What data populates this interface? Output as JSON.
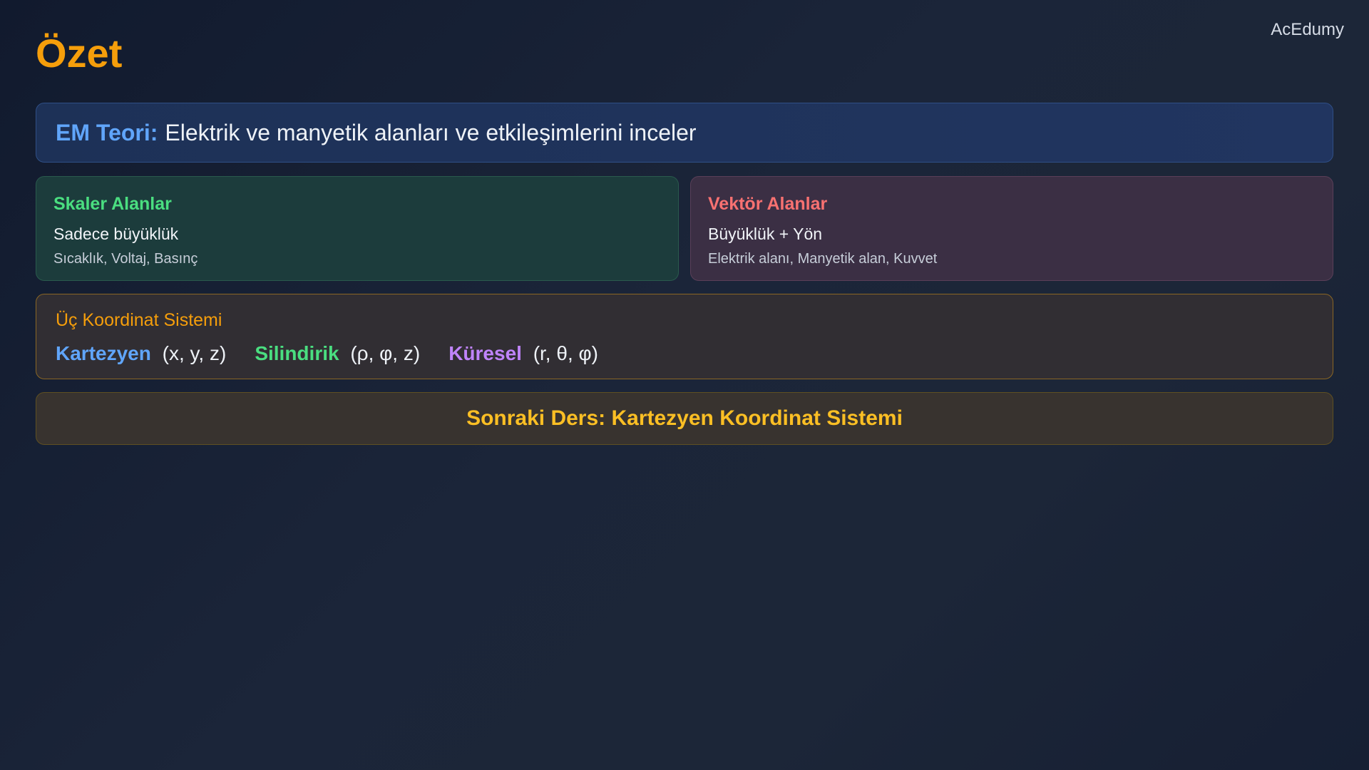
{
  "brand": "AcEdumy",
  "title": "Özet",
  "em_theory": {
    "label": "EM Teori:",
    "text": "Elektrik ve manyetik alanları ve etkileşimlerini inceler"
  },
  "scalar": {
    "title": "Skaler Alanlar",
    "subtitle": "Sadece büyüklük",
    "examples": "Sıcaklık, Voltaj, Basınç"
  },
  "vector": {
    "title": "Vektör Alanlar",
    "subtitle": "Büyüklük + Yön",
    "examples": "Elektrik alanı, Manyetik alan, Kuvvet"
  },
  "coordinates": {
    "title": "Üç Koordinat Sistemi",
    "items": [
      {
        "name": "Kartezyen",
        "vars": "(x, y, z)"
      },
      {
        "name": "Silindirik",
        "vars": "(ρ, φ, z)"
      },
      {
        "name": "Küresel",
        "vars": "(r, θ, φ)"
      }
    ]
  },
  "next_lesson": "Sonraki Ders: Kartezyen Koordinat Sistemi",
  "colors": {
    "accent": "#f59e0b",
    "blue": "#60a5fa",
    "green": "#4ade80",
    "red": "#f87171",
    "purple": "#c084fc",
    "yellow": "#fbbf24"
  }
}
